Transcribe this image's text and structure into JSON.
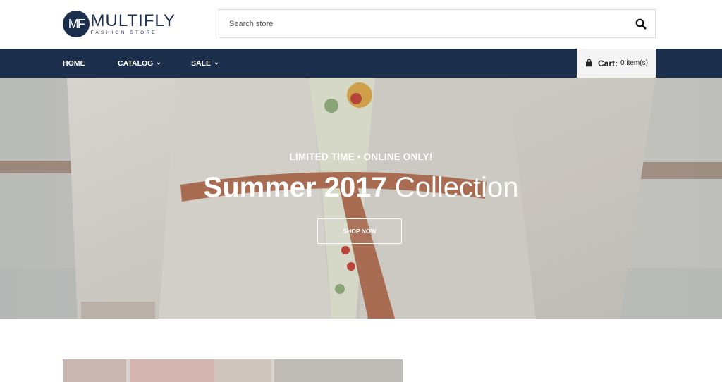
{
  "brand": {
    "logo_mark": "MF",
    "name": "MULTIFLY",
    "tagline": "FASHION STORE"
  },
  "search": {
    "placeholder": "Search store",
    "icon": "search-icon"
  },
  "nav": {
    "items": [
      {
        "label": "HOME",
        "has_dropdown": false
      },
      {
        "label": "CATALOG",
        "has_dropdown": true
      },
      {
        "label": "SALE",
        "has_dropdown": true
      }
    ]
  },
  "cart": {
    "icon": "shopping-bag-icon",
    "label": "Cart:",
    "count_text": "0 item(s)"
  },
  "hero": {
    "eyebrow": "LIMITED TIME • ONLINE ONLY!",
    "title_bold": "Summer 2017",
    "title_light": "Collection",
    "button_label": "SHOP NOW"
  },
  "colors": {
    "brand_navy": "#1b2f4c",
    "cart_bg": "#f4f4f4",
    "white": "#ffffff"
  }
}
